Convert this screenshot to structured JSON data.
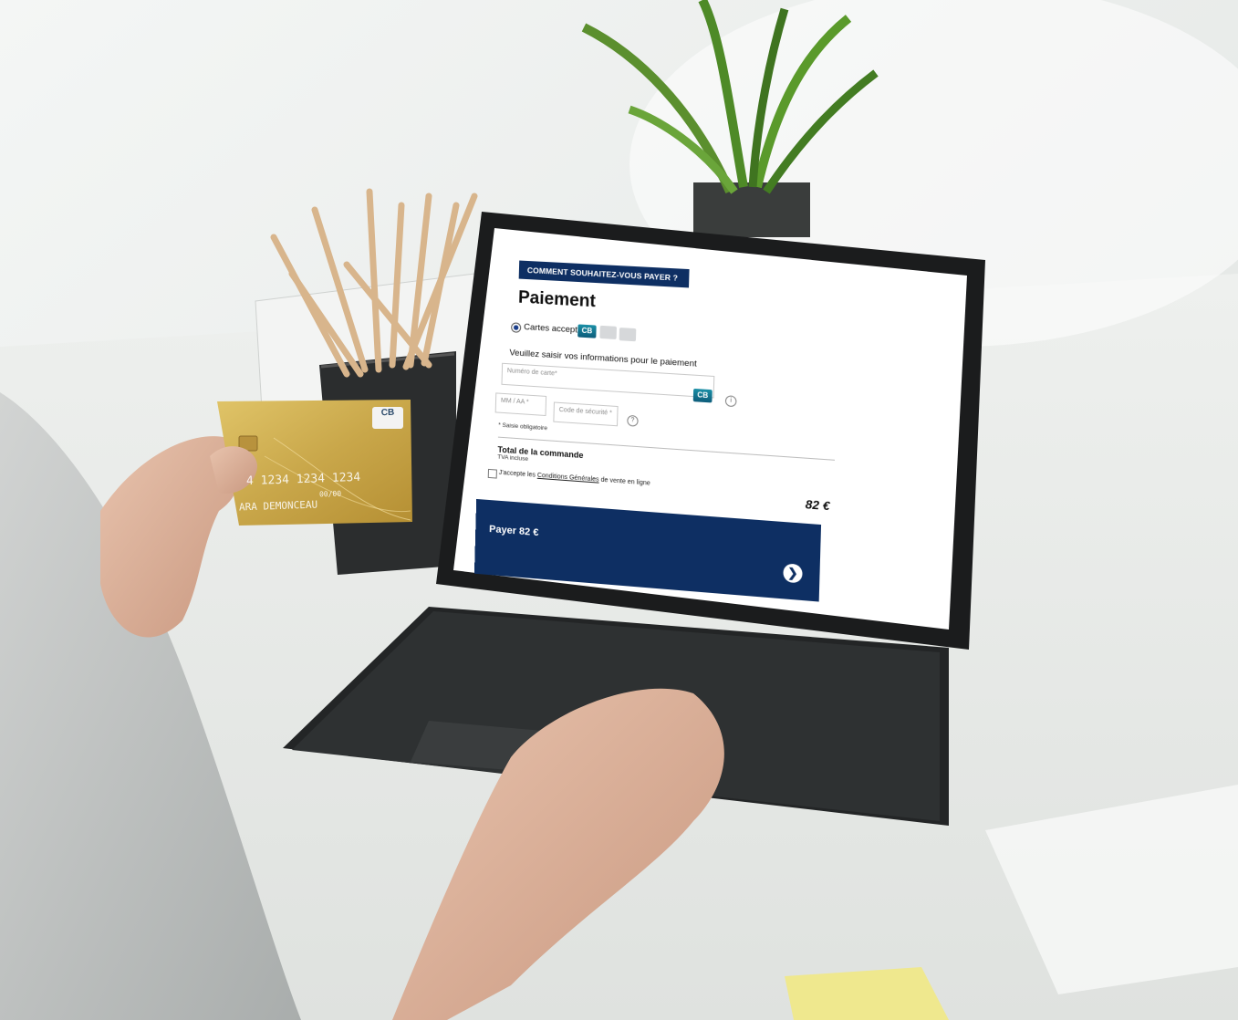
{
  "scene": {
    "description_key": "woman-paying-on-tablet"
  },
  "payment": {
    "section_title": "COMMENT SOUHAITEZ-VOUS PAYER ?",
    "page_title": "Paiement",
    "method_label": "Cartes acceptées",
    "card_logo_text": "CB",
    "instruction": "Veuillez saisir vos informations pour le paiement",
    "card_number_placeholder": "Numéro de carte*",
    "expiry_placeholder": "MM / AA *",
    "security_code_placeholder": "Code de sécurité *",
    "info_icon": "i",
    "help_icon": "?",
    "required_note": "* Saisie obligatoire",
    "total_label": "Total de la commande",
    "vat_note": "TVA incluse",
    "terms_prefix": "J'accepte les ",
    "terms_link": "Conditions Générales",
    "terms_suffix": " de vente en ligne",
    "total_amount": "82 €",
    "pay_button_label": "Payer 82 €",
    "arrow_glyph": "❯"
  },
  "gold_card": {
    "logo_text": "CB",
    "number_fragment": "4 1234 1234 1234",
    "expiry_label": "00/00",
    "holder_fragment": "ARA DEMONCEAU"
  },
  "colors": {
    "brand_navy": "#0e2f63",
    "card_gold": "#c9a74a"
  }
}
